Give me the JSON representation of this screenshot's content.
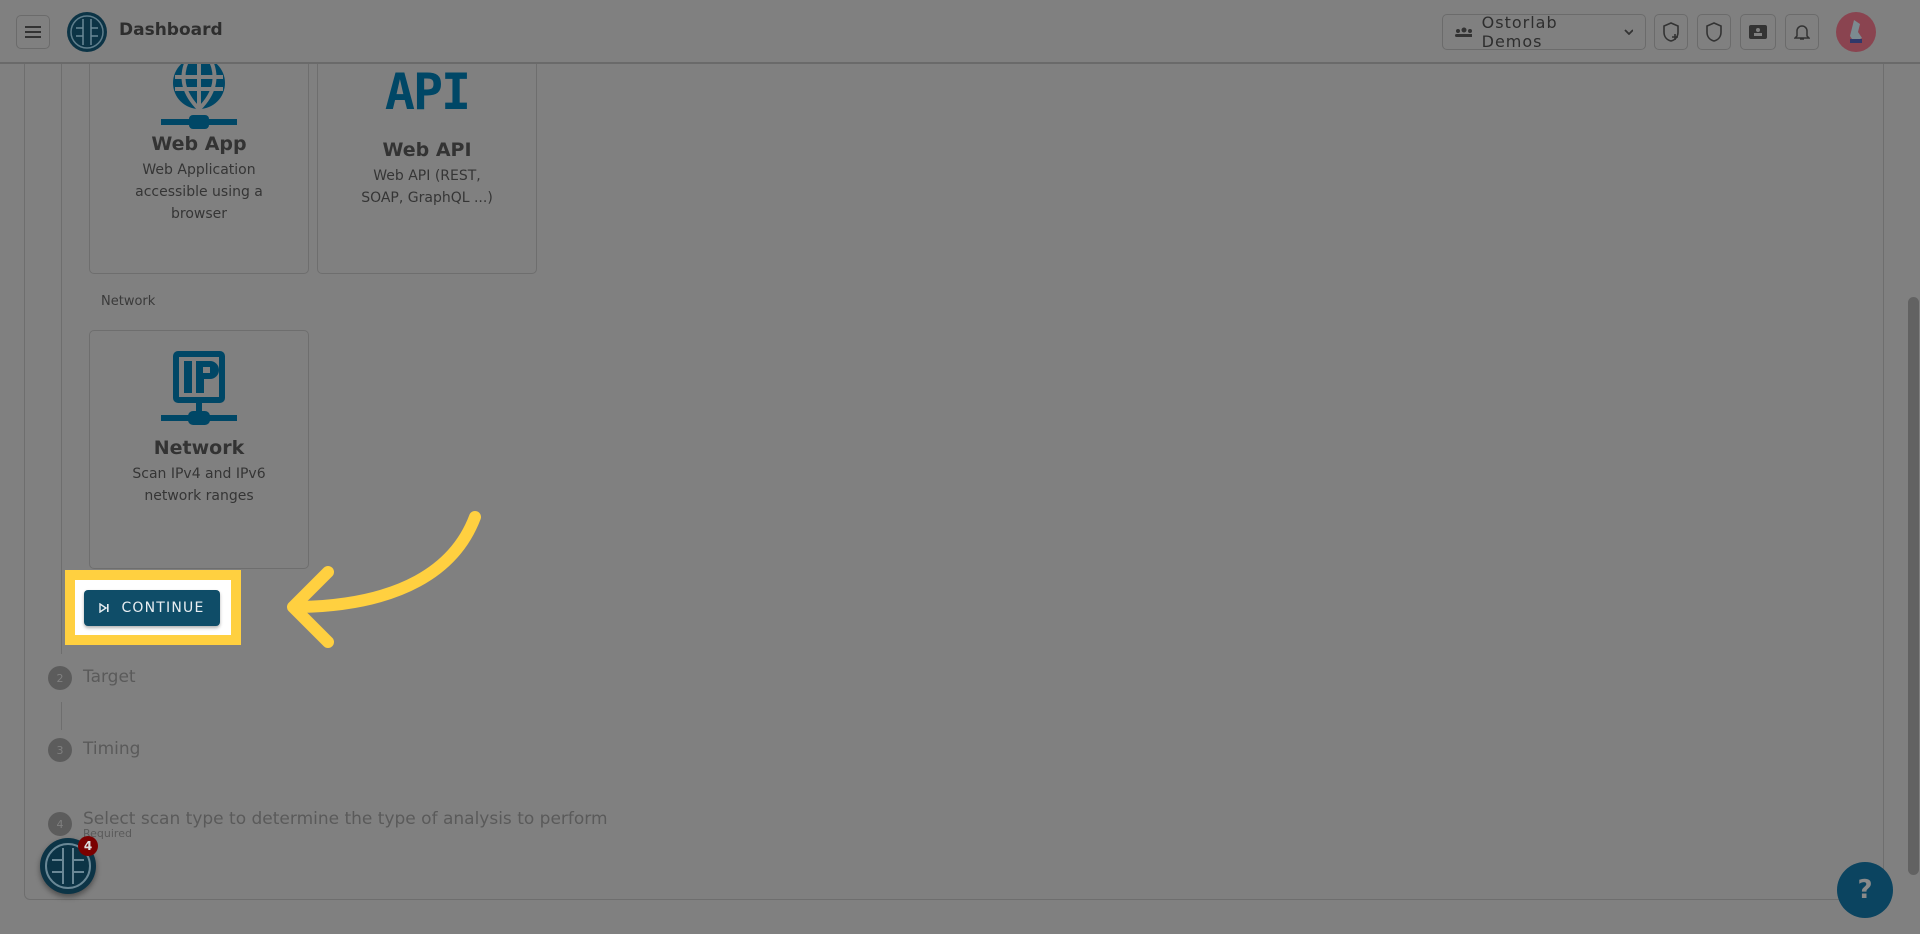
{
  "header": {
    "title": "Dashboard",
    "org_selector": "Ostorlab Demos",
    "icons": [
      "menu-icon",
      "shield-plus-icon",
      "shield-icon",
      "ticket-icon",
      "bell-icon"
    ]
  },
  "asset_types": [
    {
      "title": "Web App",
      "description": "Web Application accessible using a browser",
      "icon": "globe-network-icon"
    },
    {
      "title": "Web API",
      "description": "Web API (REST, SOAP, GraphQL ...)",
      "icon": "api-icon"
    }
  ],
  "network_section": {
    "label": "Network",
    "card": {
      "title": "Network",
      "description": "Scan IPv4 and IPv6 network ranges",
      "icon": "ip-network-icon"
    }
  },
  "continue_button": "CONTINUE",
  "steps": [
    {
      "number": "2",
      "label": "Target"
    },
    {
      "number": "3",
      "label": "Timing"
    },
    {
      "number": "4",
      "label": "Select scan type to determine the type of analysis to perform",
      "sub": "Required"
    }
  ],
  "widget_badge": "4",
  "help_label": "?",
  "colors": {
    "accent": "#0f4d68",
    "highlight": "#ffd040",
    "overlay": "#808080"
  }
}
